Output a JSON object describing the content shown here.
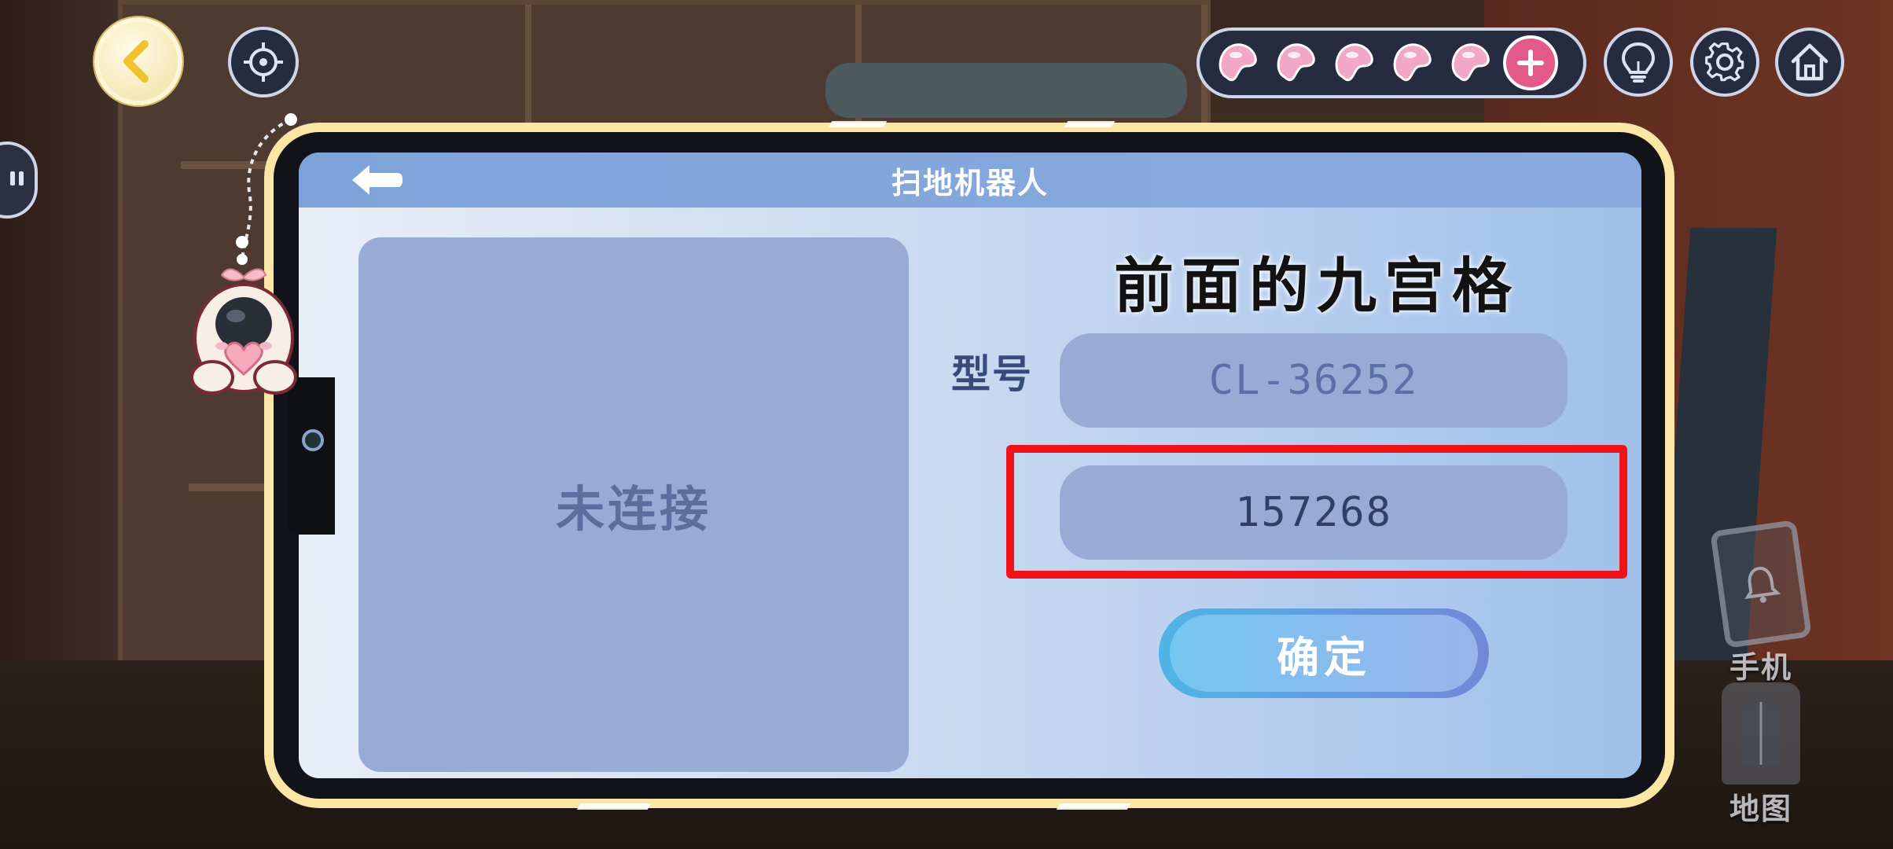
{
  "hud": {
    "back_icon": "back-arrow-icon",
    "target_icon": "crosshair-icon",
    "beans_count": 5,
    "bean_icon": "jelly-bean-icon",
    "plus_icon": "plus-icon",
    "hint_icon": "lightbulb-icon",
    "settings_icon": "gear-icon",
    "home_icon": "home-icon"
  },
  "dialog": {
    "title": "扫地机器人",
    "status": "未连接",
    "hint": "前面的九宫格",
    "model_label": "型号",
    "model_value": "CL-36252",
    "code_value": "157268",
    "confirm_label": "确定"
  },
  "side": {
    "phone_label": "手机",
    "map_label": "地图"
  },
  "colors": {
    "accent_pink": "#e35a8a",
    "highlight_red": "#f0141a",
    "panel_blue": "#98abd4",
    "titlebar_blue": "#7ea3d8"
  }
}
